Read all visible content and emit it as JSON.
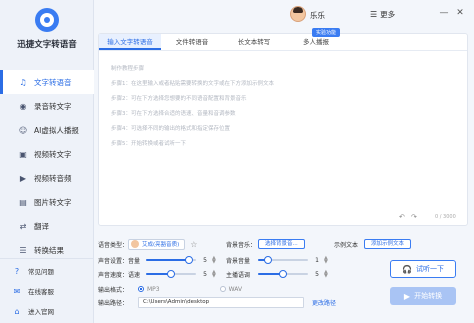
{
  "app": {
    "name": "迅捷文字转语音"
  },
  "sidebar": {
    "items": [
      {
        "label": "文字转语音",
        "icon": "text-to-speech-icon"
      },
      {
        "label": "录音转文字",
        "icon": "microphone-icon"
      },
      {
        "label": "AI虚拟人播报",
        "icon": "ai-avatar-icon"
      },
      {
        "label": "视频转文字",
        "icon": "video-icon"
      },
      {
        "label": "视频转音频",
        "icon": "video-audio-icon"
      },
      {
        "label": "图片转文字",
        "icon": "image-icon"
      },
      {
        "label": "翻译",
        "icon": "translate-icon"
      },
      {
        "label": "转换结果",
        "icon": "results-icon"
      }
    ],
    "bottom": [
      {
        "label": "常见问题",
        "icon": "help-icon"
      },
      {
        "label": "在线客服",
        "icon": "chat-icon"
      },
      {
        "label": "进入官网",
        "icon": "home-icon"
      }
    ]
  },
  "header": {
    "username": "乐乐",
    "vip_badge": "实验功能",
    "more_label": "更多",
    "minimize": "—",
    "close": "✕"
  },
  "tabs": [
    "输入文字转语音",
    "文件转语音",
    "长文本转写",
    "多人播报"
  ],
  "editor": {
    "guide": [
      "制作教程步骤",
      "步骤1：在这里输入或者粘贴需要转换的文字或在下方添加示例文本",
      "步骤2：可在下方选择您想要的不同语音配置和背景音乐",
      "步骤3：可在下方选择合适的语速、音量和音调参数",
      "步骤4：可选择不同的输出的格式和指定保存位置",
      "步骤5：开始转换或者试听一下"
    ],
    "char_count": "0 / 3000"
  },
  "settings": {
    "voice_type_label": "语音类型：",
    "voice_name": "艾成(亮豁音质)",
    "bgm_label": "背景音乐：",
    "bgm_button": "选择背景音...",
    "sample_label": "示例文本",
    "sample_button": "添加示例文本",
    "voice_settings_label": "声音设置：",
    "volume_label": "音量",
    "volume_value": "5",
    "bgm_volume_label": "背景音量",
    "bgm_volume_value": "1",
    "speed_label": "声音速度：",
    "speed_sub_label": "语速",
    "speed_value": "5",
    "pitch_label": "主播语调",
    "pitch_value": "5",
    "format_label": "输出格式：",
    "format_options": [
      "MP3",
      "WAV"
    ],
    "format_selected": "MP3",
    "path_label": "输出路径：",
    "path_value": "C:\\Users\\Admin\\desktop",
    "change_path": "更改路径",
    "listen_button": "试听一下",
    "start_button": "开始转换",
    "volume_fraction": 0.85,
    "bgm_volume_fraction": 0.2,
    "speed_fraction": 0.5,
    "pitch_fraction": 0.5
  },
  "colors": {
    "accent": "#2b6de5",
    "disabled_button": "#a9c4f4"
  }
}
